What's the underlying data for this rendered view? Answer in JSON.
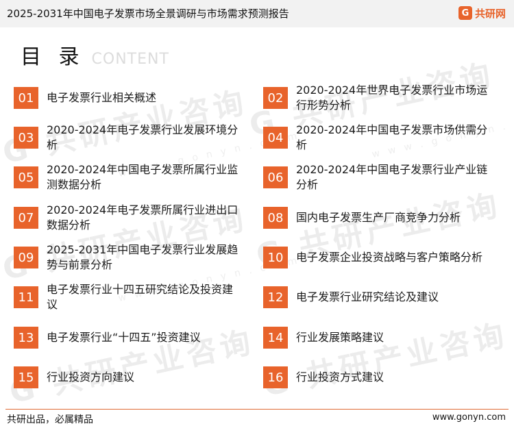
{
  "header": {
    "title": "2025-2031年中国电子发票市场全景调研与市场需求预测报告",
    "brand_logo_glyph": "G",
    "brand_name": "共研网",
    "brand_color": "#e8632b"
  },
  "toc": {
    "heading_cn": "目 录",
    "heading_en": "CONTENT",
    "left_items": [
      {
        "num": "01",
        "text": "电子发票行业相关概述"
      },
      {
        "num": "03",
        "text": "2020-2024年电子发票行业发展环境分析"
      },
      {
        "num": "05",
        "text": "2020-2024年中国电子发票所属行业监测数据分析"
      },
      {
        "num": "07",
        "text": "2020-2024年电子发票所属行业进出口数据分析"
      },
      {
        "num": "09",
        "text": "2025-2031年中国电子发票行业发展趋势与前景分析"
      },
      {
        "num": "11",
        "text": "电子发票行业十四五研究结论及投资建议"
      },
      {
        "num": "13",
        "text": "电子发票行业“十四五”投资建议"
      },
      {
        "num": "15",
        "text": "行业投资方向建议"
      }
    ],
    "right_items": [
      {
        "num": "02",
        "text": "2020-2024年世界电子发票行业市场运行形势分析"
      },
      {
        "num": "04",
        "text": "2020-2024年中国电子发票市场供需分析"
      },
      {
        "num": "06",
        "text": "2020-2024年中国电子发票行业产业链分析"
      },
      {
        "num": "08",
        "text": "国内电子发票生产厂商竞争力分析"
      },
      {
        "num": "10",
        "text": "电子发票企业投资战略与客户策略分析"
      },
      {
        "num": "12",
        "text": "电子发票行业研究结论及建议"
      },
      {
        "num": "14",
        "text": "行业发展策略建议"
      },
      {
        "num": "16",
        "text": "行业投资方式建议"
      }
    ]
  },
  "footer": {
    "slogan": "共研出品，必属精品",
    "url": "www.gonyn.com"
  }
}
